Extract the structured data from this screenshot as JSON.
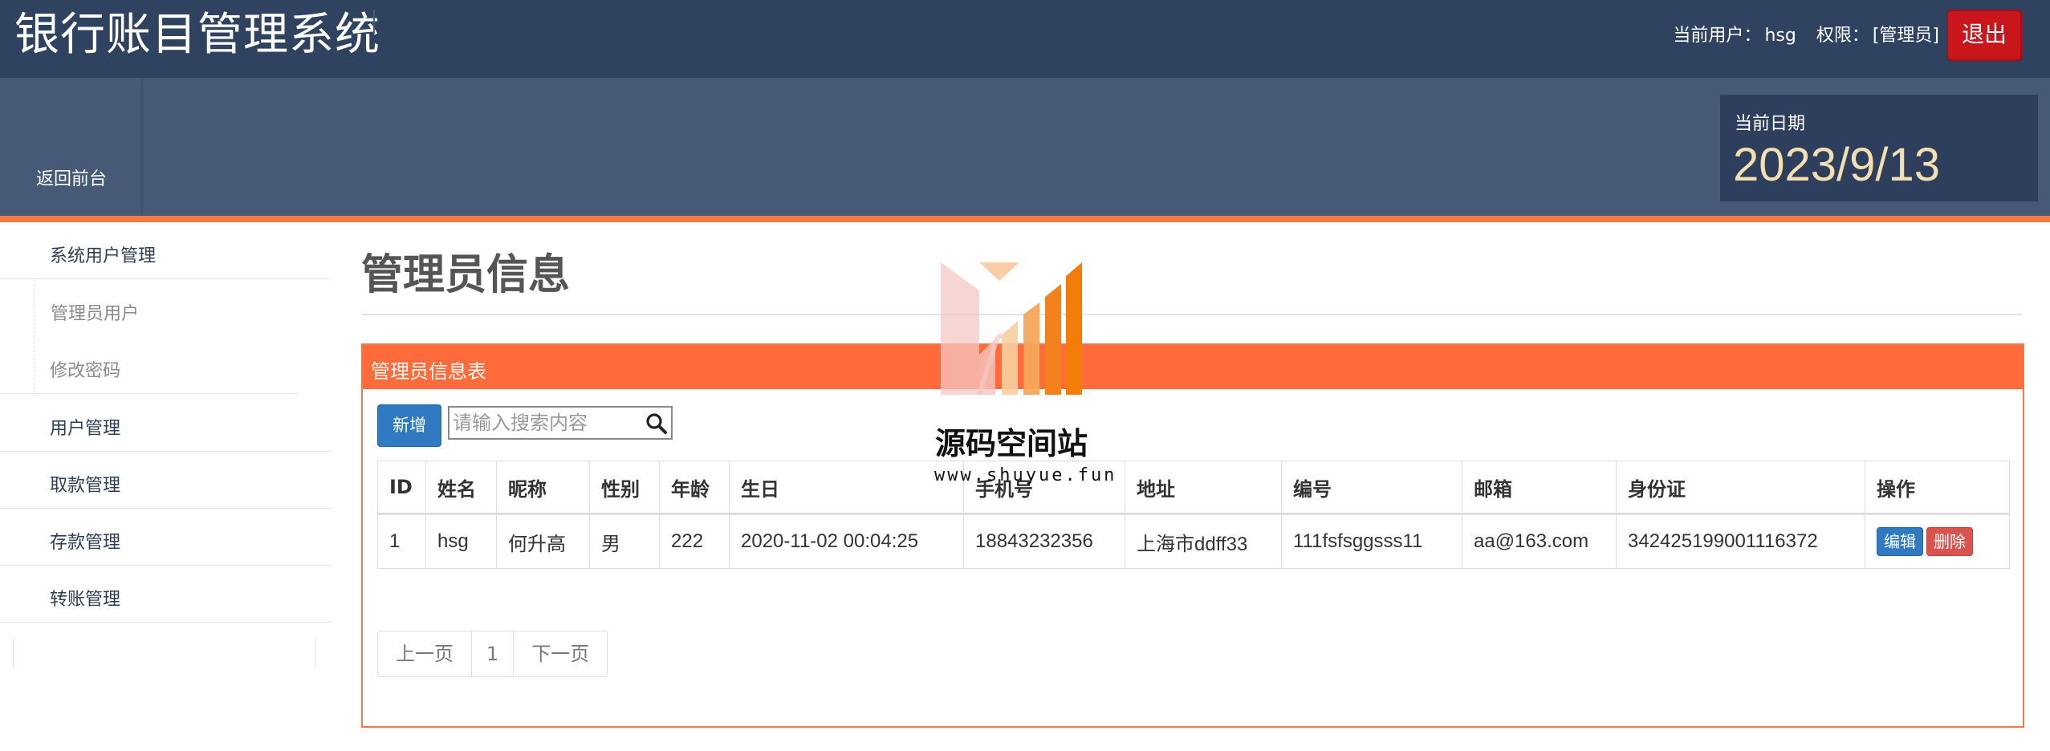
{
  "header": {
    "app_title": "银行账目管理系统",
    "current_user_label": "当前用户：",
    "current_user": "hsg",
    "role_label": "权限：",
    "role": "[管理员]",
    "logout_label": "退出"
  },
  "subheader": {
    "back_label": "返回前台",
    "date_label": "当前日期",
    "date_value": "2023/9/13"
  },
  "sidebar": {
    "items": [
      {
        "label": "系统用户管理"
      },
      {
        "label": "管理员用户"
      },
      {
        "label": "修改密码"
      },
      {
        "label": "用户管理"
      },
      {
        "label": "取款管理"
      },
      {
        "label": "存款管理"
      },
      {
        "label": "转账管理"
      }
    ]
  },
  "main": {
    "page_title": "管理员信息",
    "panel_title": "管理员信息表",
    "add_label": "新增",
    "search_placeholder": "请输入搜索内容",
    "columns": [
      "ID",
      "姓名",
      "昵称",
      "性别",
      "年龄",
      "生日",
      "手机号",
      "地址",
      "编号",
      "邮箱",
      "身份证",
      "操作"
    ],
    "rows": [
      [
        "1",
        "hsg",
        "何升高",
        "男",
        "222",
        "2020-11-02 00:04:25",
        "18843232356",
        "上海市ddff33",
        "111fsfsggsss11",
        "aa@163.com",
        "342425199001116372"
      ]
    ],
    "row_actions": {
      "edit": "编辑",
      "delete": "删除"
    },
    "pager": {
      "prev": "上一页",
      "page": "1",
      "next": "下一页"
    }
  },
  "watermark": {
    "text": "源码空间站",
    "url": "www.shuyue.fun"
  },
  "colors": {
    "topbar": "#2f4260",
    "band": "#465a78",
    "accent_orange": "#ff6b3a",
    "primary_blue": "#2f7ac0",
    "danger_red": "#d9534f",
    "logout_red": "#c9151c",
    "date_value": "#f4dfb1"
  },
  "icons": [
    "search-icon",
    "logo-watermark-icon"
  ]
}
